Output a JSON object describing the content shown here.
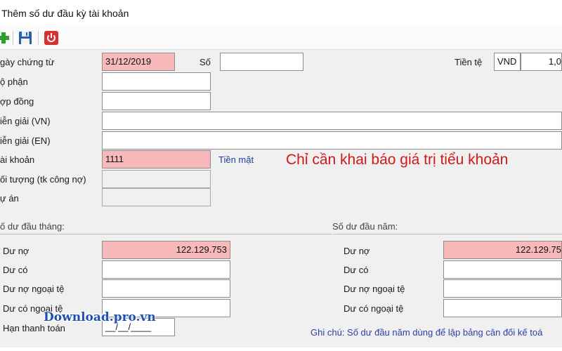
{
  "window": {
    "title": "Thêm số dư đầu kỳ tài khoản"
  },
  "toolbar": {
    "icons": [
      "add-icon",
      "save-icon",
      "power-icon"
    ]
  },
  "form": {
    "ngay_label": "gày chứng từ",
    "ngay_value": "31/12/2019",
    "so_label": "Số",
    "so_value": "",
    "tiente_label": "Tiền tệ",
    "tiente_code": "VND",
    "tiente_rate": "1,0",
    "bophan_label": "ộ phận",
    "bophan_value": "",
    "hopdong_label": "ợp đồng",
    "hopdong_value": "",
    "diengiai_vn_label": "iễn giải (VN)",
    "diengiai_vn_value": "",
    "diengiai_en_label": "iễn giải (EN)",
    "diengiai_en_value": "",
    "taikhoan_label": "ài khoản",
    "taikhoan_value": "1111",
    "taikhoan_name": "Tiền mặt",
    "doituong_label": "ối tượng (tk công nợ)",
    "doituong_value": "",
    "duan_label": "ự án",
    "duan_value": ""
  },
  "callout": "Chỉ cần khai báo giá trị tiểu khoản",
  "monthly": {
    "title": "ố dư đầu tháng:",
    "du_no_label": "Dư nợ",
    "du_no_value": "122.129.753",
    "du_co_label": "Dư có",
    "du_co_value": "",
    "du_no_nt_label": "Dư nợ ngoại tệ",
    "du_no_nt_value": "",
    "du_co_nt_label": "Dư có ngoại tệ",
    "du_co_nt_value": "",
    "han_label": "Hạn thanh toán",
    "han_value": "__/__/____"
  },
  "yearly": {
    "title": "Số dư đầu năm:",
    "du_no_label": "Dư nợ",
    "du_no_value": "122.129.75",
    "du_co_label": "Dư có",
    "du_co_value": "",
    "du_no_nt_label": "Dư nợ ngoại tệ",
    "du_no_nt_value": "",
    "du_co_nt_label": "Dư có ngoại tệ",
    "du_co_nt_value": ""
  },
  "note": "Ghi chú: Số dư đầu năm dùng để lập bảng cân đối kế toá",
  "watermark": "Download.pro.vn",
  "colors": {
    "required_field": "#f7b9b9",
    "callout": "#d01818",
    "link": "#1a3fa0"
  }
}
